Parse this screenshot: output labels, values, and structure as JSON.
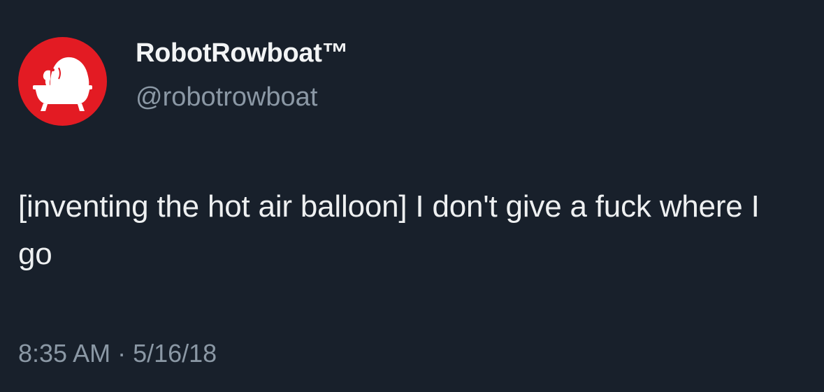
{
  "author": {
    "display_name": "RobotRowboat™",
    "handle": "@robotrowboat",
    "avatar_icon": "elephant-in-bathtub-icon",
    "avatar_bg": "#e31b23"
  },
  "tweet": {
    "text": "[inventing the hot air balloon] I don't give a fuck where I go",
    "time": "8:35 AM",
    "separator": "·",
    "date": "5/16/18"
  },
  "colors": {
    "background": "#18202b",
    "primary_text": "#e7e9ea",
    "secondary_text": "#8b98a5"
  }
}
